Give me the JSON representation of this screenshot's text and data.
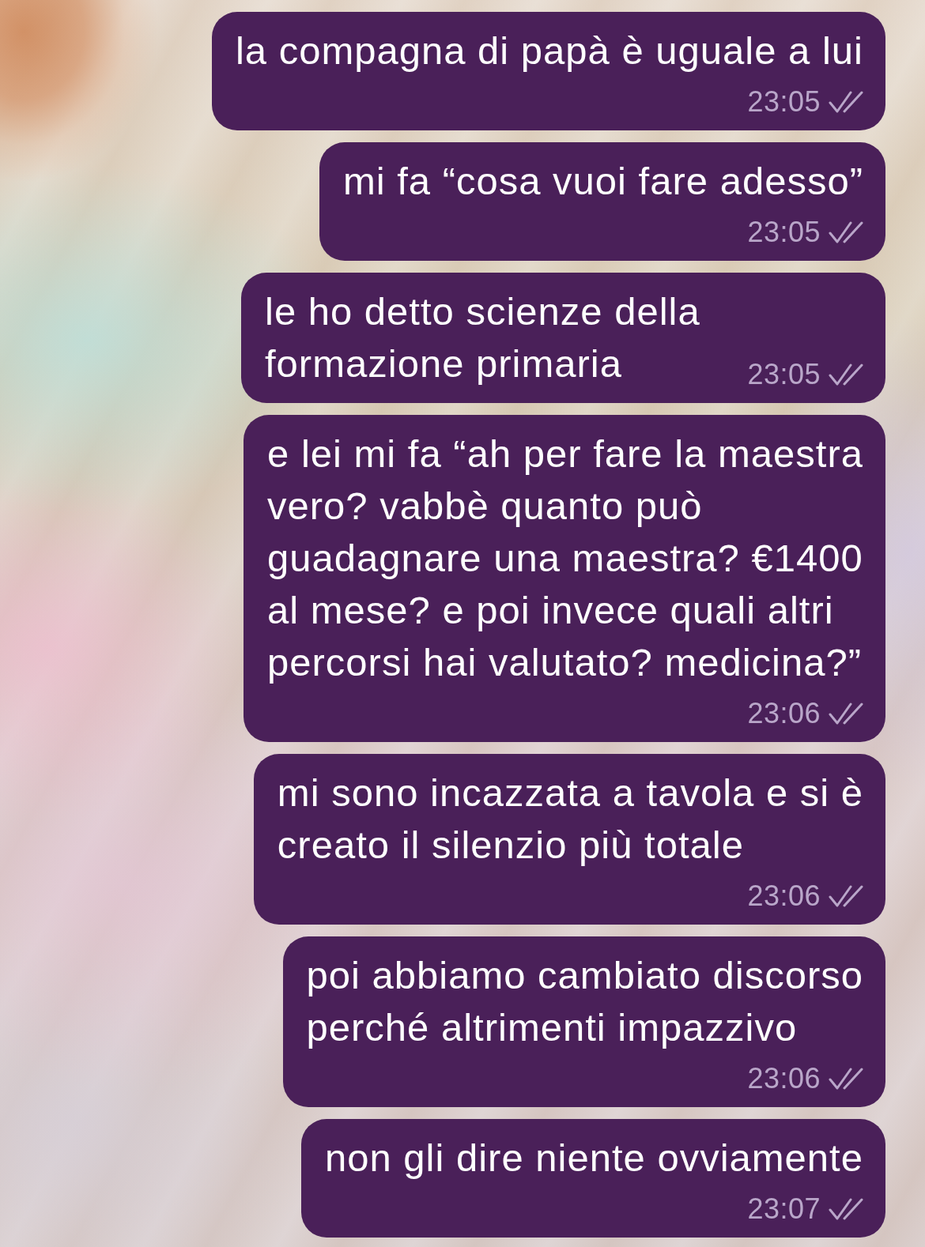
{
  "messages": [
    {
      "text": "la compagna di papà è uguale a lui",
      "time": "23:05",
      "read": true
    },
    {
      "text": "mi fa “cosa vuoi fare adesso”",
      "time": "23:05",
      "read": true
    },
    {
      "text": "le ho detto scienze della\nformazione primaria",
      "time": "23:05",
      "read": true
    },
    {
      "text": "e lei mi fa “ah per fare la maestra\nvero? vabbè quanto può\nguadagnare una maestra? €1400\nal mese? e poi invece quali altri\npercorsi hai valutato? medicina?”",
      "time": "23:06",
      "read": true
    },
    {
      "text": "mi sono incazzata a tavola e si è\ncreato il silenzio più totale",
      "time": "23:06",
      "read": true
    },
    {
      "text": "poi abbiamo cambiato discorso\nperché altrimenti impazzivo",
      "time": "23:06",
      "read": true
    },
    {
      "text": "non gli dire niente ovviamente",
      "time": "23:07",
      "read": true
    }
  ]
}
